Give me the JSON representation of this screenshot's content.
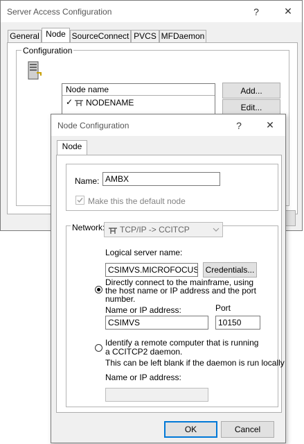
{
  "back_window": {
    "title": "Server Access Configuration",
    "help_glyph": "?",
    "close_glyph": "✕",
    "tabs": [
      "General",
      "Node",
      "SourceConnect",
      "PVCS",
      "MFDaemon"
    ],
    "group_label": "Configuration",
    "list_header": "Node name",
    "list_item": "NODENAME",
    "list_item_prefix": "✓",
    "add_button": "Add...",
    "edit_button": "Edit..."
  },
  "dialog": {
    "title": "Node Configuration",
    "help_glyph": "?",
    "close_glyph": "✕",
    "tab": "Node",
    "name_label": "Name:",
    "name_value": "AMBX",
    "default_node_label": "Make this the default node",
    "network_label": "Network:",
    "network_value": "TCP/IP -> CCITCP",
    "logical_server_label": "Logical server name:",
    "logical_server_value": "CSIMVS.MICROFOCUS.CC",
    "credentials_button": "Credentials...",
    "option1_text": "Directly connect to the mainframe, using the host name or IP address and the port number.",
    "name_ip_label": "Name or IP address:",
    "port_label": "Port",
    "host_value": "CSIMVS",
    "port_value": "10150",
    "option2_text": "Identify a remote computer that is running a CCITCP2 daemon.",
    "blank_note": "This can be left blank if the daemon is run locally",
    "name_ip_label2": "Name or IP address:",
    "ok_button": "OK",
    "cancel_button": "Cancel"
  }
}
